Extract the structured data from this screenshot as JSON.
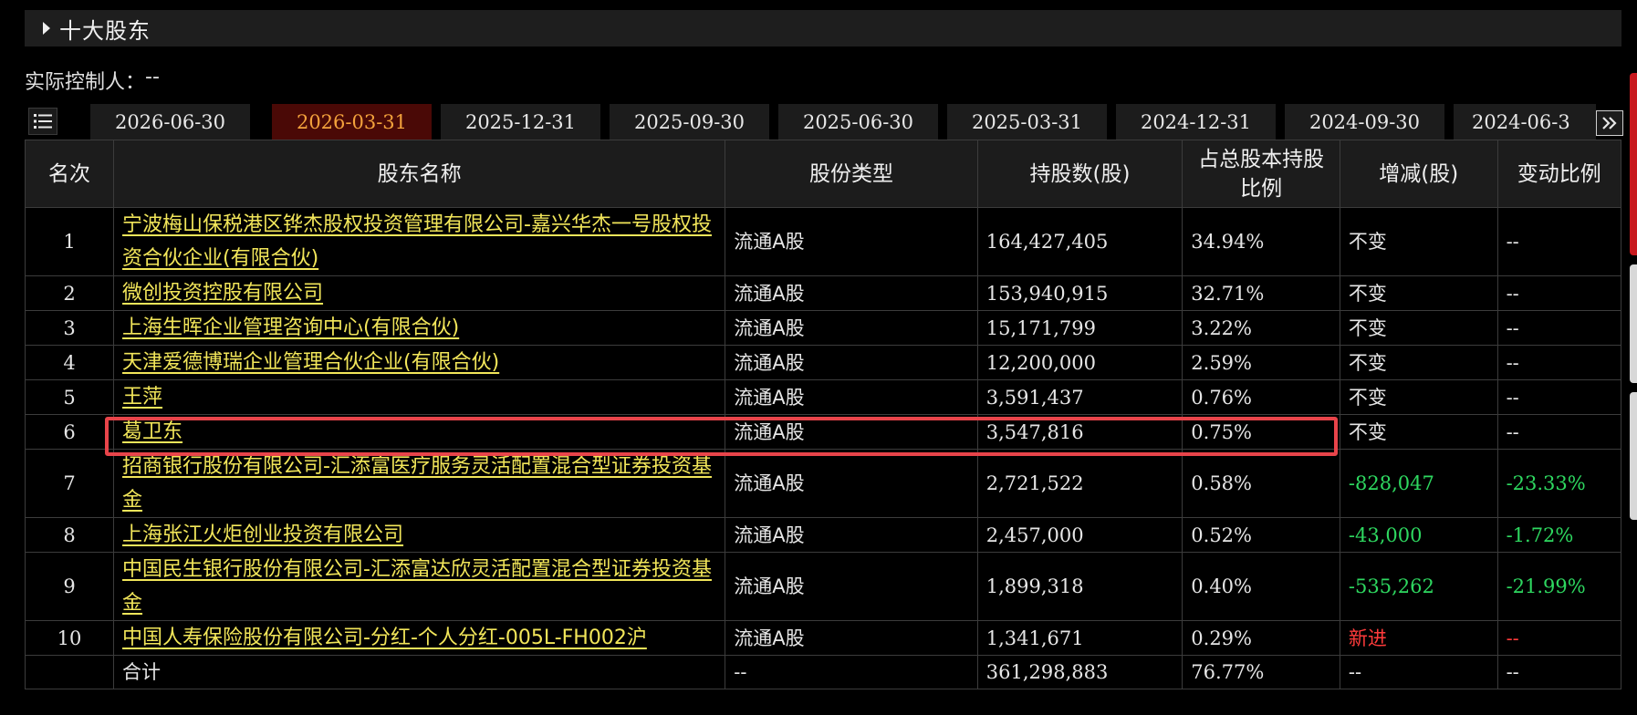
{
  "section": {
    "title": "十大股东"
  },
  "controller": {
    "label": "实际控制人：",
    "value": "--"
  },
  "tabs": [
    {
      "label": "2026-06-30",
      "active": false
    },
    {
      "label": "2026-03-31",
      "active": true
    },
    {
      "label": "2025-12-31",
      "active": false
    },
    {
      "label": "2025-09-30",
      "active": false
    },
    {
      "label": "2025-06-30",
      "active": false
    },
    {
      "label": "2025-03-31",
      "active": false
    },
    {
      "label": "2024-12-31",
      "active": false
    },
    {
      "label": "2024-09-30",
      "active": false
    },
    {
      "label": "2024-06-3",
      "active": false
    }
  ],
  "table": {
    "headers": {
      "rank": "名次",
      "name": "股东名称",
      "type": "股份类型",
      "shares": "持股数(股)",
      "ratio": "占总股本持股比例",
      "change": "增减(股)",
      "change_ratio": "变动比例"
    },
    "rows": [
      {
        "rank": "1",
        "name": "宁波梅山保税港区铧杰股权投资管理有限公司-嘉兴华杰一号股权投资合伙企业(有限合伙)",
        "type": "流通A股",
        "shares": "164,427,405",
        "ratio": "34.94%",
        "change": "不变",
        "change_ratio": "--",
        "trend": "flat"
      },
      {
        "rank": "2",
        "name": "微创投资控股有限公司",
        "type": "流通A股",
        "shares": "153,940,915",
        "ratio": "32.71%",
        "change": "不变",
        "change_ratio": "--",
        "trend": "flat"
      },
      {
        "rank": "3",
        "name": "上海生晖企业管理咨询中心(有限合伙)",
        "type": "流通A股",
        "shares": "15,171,799",
        "ratio": "3.22%",
        "change": "不变",
        "change_ratio": "--",
        "trend": "flat"
      },
      {
        "rank": "4",
        "name": "天津爱德博瑞企业管理合伙企业(有限合伙)",
        "type": "流通A股",
        "shares": "12,200,000",
        "ratio": "2.59%",
        "change": "不变",
        "change_ratio": "--",
        "trend": "flat"
      },
      {
        "rank": "5",
        "name": "王萍",
        "type": "流通A股",
        "shares": "3,591,437",
        "ratio": "0.76%",
        "change": "不变",
        "change_ratio": "--",
        "trend": "flat"
      },
      {
        "rank": "6",
        "name": "葛卫东",
        "type": "流通A股",
        "shares": "3,547,816",
        "ratio": "0.75%",
        "change": "不变",
        "change_ratio": "--",
        "trend": "flat"
      },
      {
        "rank": "7",
        "name": "招商银行股份有限公司-汇添富医疗服务灵活配置混合型证券投资基金",
        "type": "流通A股",
        "shares": "2,721,522",
        "ratio": "0.58%",
        "change": "-828,047",
        "change_ratio": "-23.33%",
        "trend": "down"
      },
      {
        "rank": "8",
        "name": "上海张江火炬创业投资有限公司",
        "type": "流通A股",
        "shares": "2,457,000",
        "ratio": "0.52%",
        "change": "-43,000",
        "change_ratio": "-1.72%",
        "trend": "down"
      },
      {
        "rank": "9",
        "name": "中国民生银行股份有限公司-汇添富达欣灵活配置混合型证券投资基金",
        "type": "流通A股",
        "shares": "1,899,318",
        "ratio": "0.40%",
        "change": "-535,262",
        "change_ratio": "-21.99%",
        "trend": "down"
      },
      {
        "rank": "10",
        "name": "中国人寿保险股份有限公司-分红-个人分红-005L-FH002沪",
        "type": "流通A股",
        "shares": "1,341,671",
        "ratio": "0.29%",
        "change": "新进",
        "change_ratio": "--",
        "trend": "up"
      }
    ],
    "total": {
      "label": "合计",
      "type": "--",
      "shares": "361,298,883",
      "ratio": "76.77%",
      "change": "--",
      "change_ratio": "--"
    }
  },
  "colors": {
    "accent_tab_bg": "#4a0906",
    "accent_tab_text": "#f3a23c",
    "link": "#f2e65a",
    "up": "#ff3b3b",
    "down": "#2ed860",
    "highlight": "#e8444a"
  },
  "icons": {
    "collapse": "triangle-right-icon",
    "list": "list-icon",
    "next": "double-chevron-right-icon"
  }
}
